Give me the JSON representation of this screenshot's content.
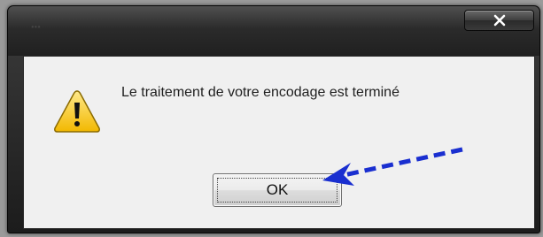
{
  "dialog": {
    "title": "...",
    "close_label": "x",
    "message": "Le traitement de votre encodage est terminé",
    "ok_label": "OK",
    "icon": "warning-icon",
    "arrow_color": "#1a2fd0"
  }
}
